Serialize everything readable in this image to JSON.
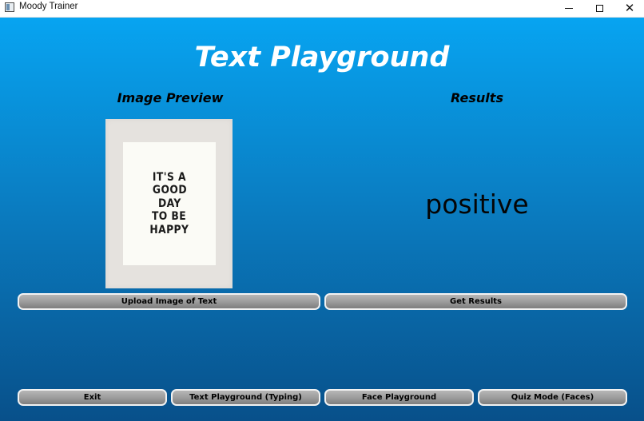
{
  "window": {
    "title": "Moody Trainer",
    "controls": {
      "minimize": "",
      "maximize": "",
      "close": "✕"
    }
  },
  "page": {
    "title": "Text Playground",
    "preview_heading": "Image Preview",
    "results_heading": "Results",
    "preview_image_text": [
      "IT'S A",
      "GOOD",
      "DAY",
      "TO BE",
      "HAPPY"
    ],
    "result_value": "positive"
  },
  "buttons": {
    "upload": "Upload Image of Text",
    "get_results": "Get Results",
    "exit": "Exit",
    "text_playground": "Text Playground (Typing)",
    "face_playground": "Face Playground",
    "quiz_mode": "Quiz Mode (Faces)"
  },
  "colors": {
    "background_top": "#07a4f1",
    "background_bottom": "#08508a",
    "button": "#9a9a9a",
    "title_text": "#ffffff"
  },
  "icons": {
    "app": "app-window-icon",
    "minimize": "minimize-icon",
    "maximize": "maximize-icon",
    "close": "close-icon"
  }
}
